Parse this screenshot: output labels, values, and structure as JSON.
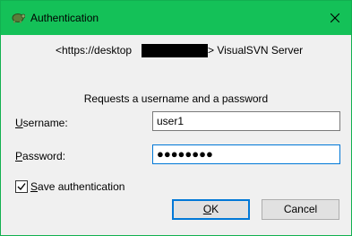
{
  "window": {
    "title": "Authentication",
    "accent_color": "#14c158",
    "app_icon": "tortoisesvn-icon",
    "close_icon": "close-icon"
  },
  "server": {
    "url_visible": "<https://desktop",
    "url_redacted": true,
    "realm": "> VisualSVN Server"
  },
  "prompt": "Requests a username and a password",
  "username": {
    "mnemonic": "U",
    "label_rest": "sername:",
    "value": "user1"
  },
  "password": {
    "mnemonic": "P",
    "label_rest": "assword:",
    "masked_value": "●●●●●●●●"
  },
  "save_auth": {
    "mnemonic": "S",
    "label_rest": "ave authentication",
    "checked": true
  },
  "buttons": {
    "ok_mnemonic": "O",
    "ok_rest": "K",
    "cancel": "Cancel"
  }
}
